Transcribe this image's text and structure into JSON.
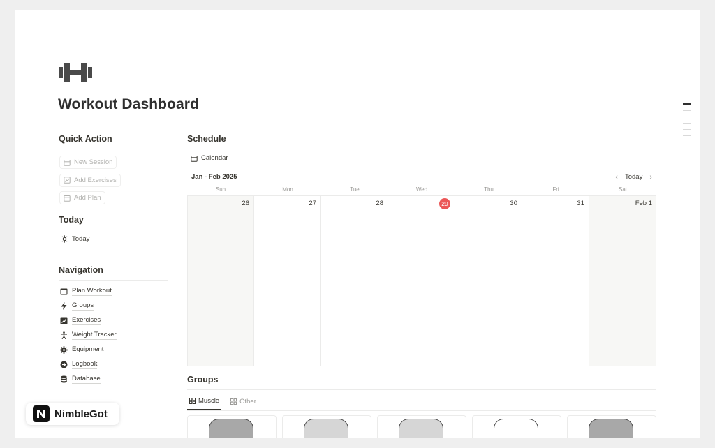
{
  "page": {
    "title": "Workout Dashboard",
    "icon": "dumbbell-icon"
  },
  "quick_action": {
    "heading": "Quick Action",
    "buttons": [
      {
        "label": "New Session",
        "icon": "calendar-icon"
      },
      {
        "label": "Add Exercises",
        "icon": "chart-icon"
      },
      {
        "label": "Add Plan",
        "icon": "calendar-icon"
      }
    ]
  },
  "today": {
    "heading": "Today",
    "item": "Today",
    "icon": "sun-icon"
  },
  "navigation": {
    "heading": "Navigation",
    "items": [
      {
        "label": "Plan Workout",
        "icon": "calendar-icon"
      },
      {
        "label": "Groups",
        "icon": "bolt-icon"
      },
      {
        "label": "Exercises",
        "icon": "chart-up-icon"
      },
      {
        "label": "Weight Tracker",
        "icon": "person-icon"
      },
      {
        "label": "Equipment",
        "icon": "gear-icon"
      },
      {
        "label": "Logbook",
        "icon": "arrow-circle-icon"
      },
      {
        "label": "Database",
        "icon": "database-icon"
      }
    ]
  },
  "schedule": {
    "heading": "Schedule",
    "view_tab": "Calendar",
    "range_label": "Jan - Feb 2025",
    "today_button": "Today",
    "weekdays": [
      "Sun",
      "Mon",
      "Tue",
      "Wed",
      "Thu",
      "Fri",
      "Sat"
    ],
    "days": [
      "26",
      "27",
      "28",
      "29",
      "30",
      "31",
      "Feb 1"
    ],
    "today_index": 3
  },
  "groups": {
    "heading": "Groups",
    "tabs": [
      {
        "label": "Muscle",
        "active": true
      },
      {
        "label": "Other",
        "active": false
      }
    ]
  },
  "brand": {
    "name": "NimbleGot"
  },
  "colors": {
    "today_badge": "#eb5757",
    "weekend_bg": "#f7f7f5",
    "text": "#37352f"
  }
}
